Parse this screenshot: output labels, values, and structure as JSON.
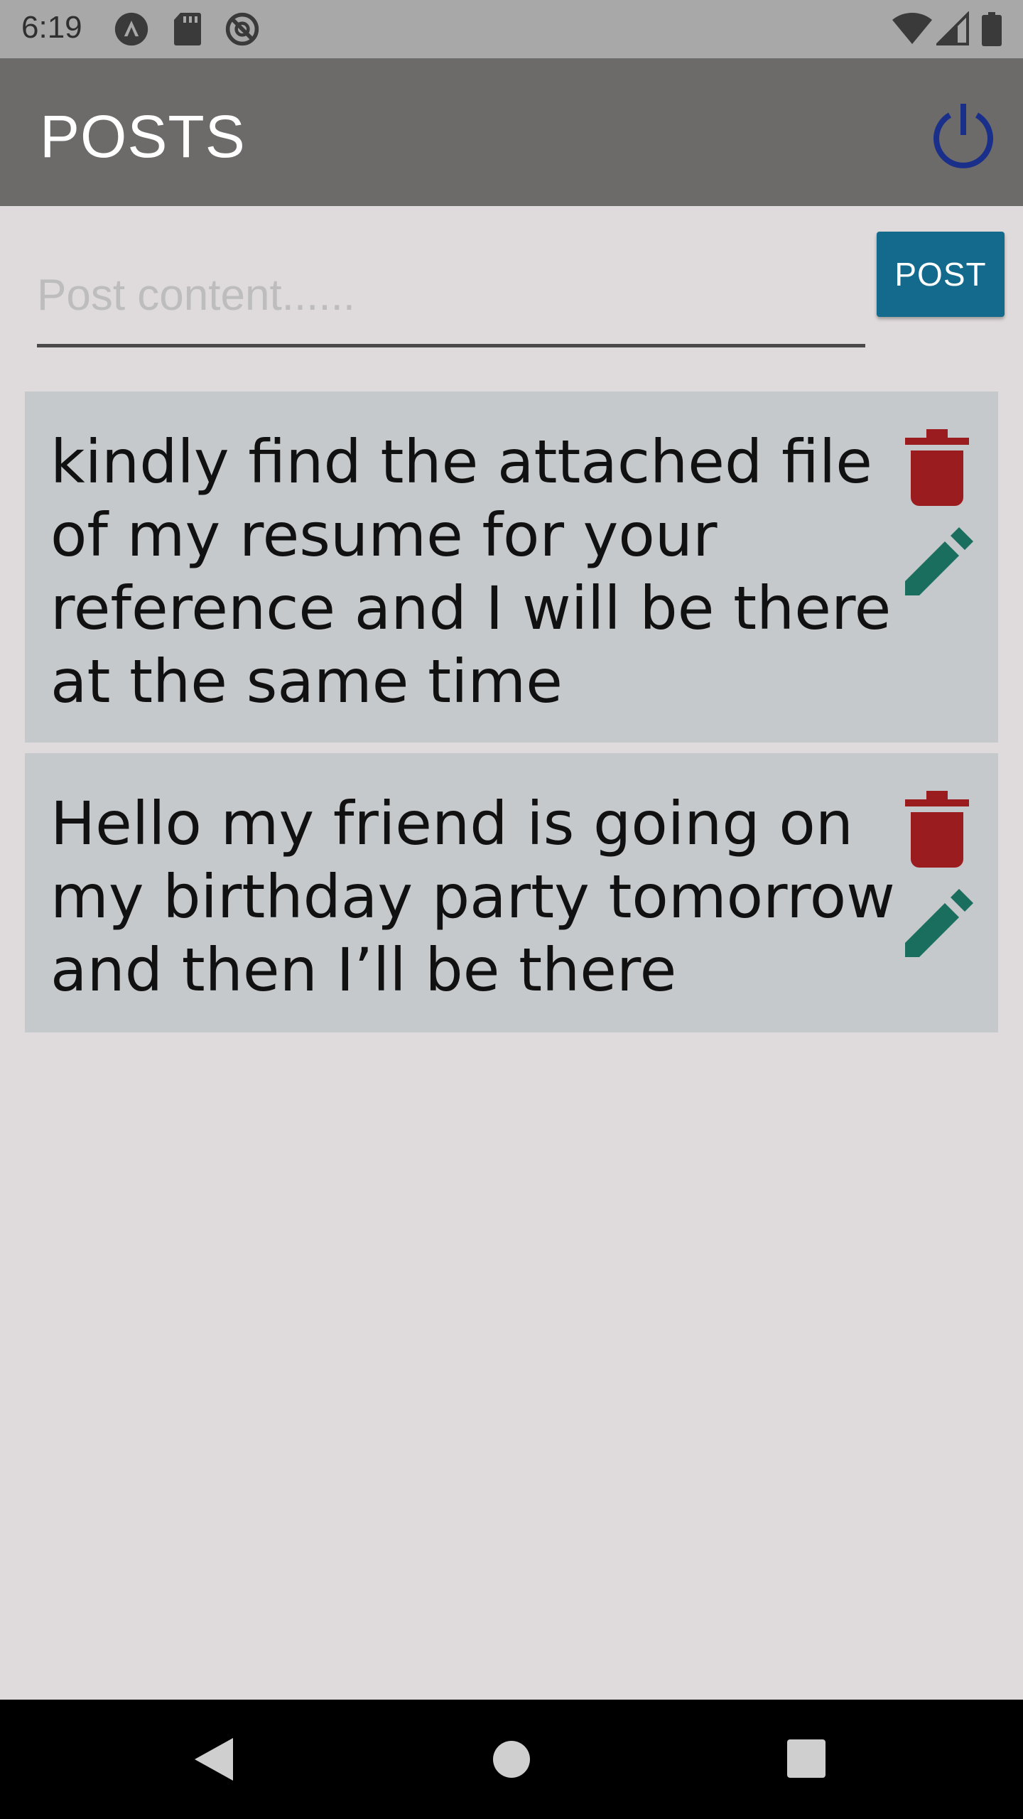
{
  "status_bar": {
    "time": "6:19",
    "left_icons": [
      "a-circle-icon",
      "sd-card-icon",
      "no-sync-icon"
    ],
    "right_icons": [
      "wifi-icon",
      "signal-icon",
      "battery-icon"
    ]
  },
  "app_bar": {
    "title": "POSTS",
    "action_icon": "power-icon",
    "action_color": "#1a2f8a",
    "background": "#6d6a6a"
  },
  "composer": {
    "placeholder": "Post content......",
    "value": "",
    "button_label": "POST",
    "button_color": "#146a8c"
  },
  "posts": [
    {
      "text": "kindly find the attached file of my resume for your reference and I will be there at the same time",
      "delete_icon": "trash-icon",
      "edit_icon": "pencil-icon"
    },
    {
      "text": "Hello my friend is going on my birthday party tomorrow and then I’ll be there",
      "delete_icon": "trash-icon",
      "edit_icon": "pencil-icon"
    }
  ],
  "colors": {
    "delete": "#9b1c1f",
    "edit": "#1a6e5e",
    "card": "#c5c9cb",
    "background": "#dfdadb"
  },
  "nav_bar": {
    "buttons": [
      "back-icon",
      "home-icon",
      "recents-icon"
    ]
  }
}
